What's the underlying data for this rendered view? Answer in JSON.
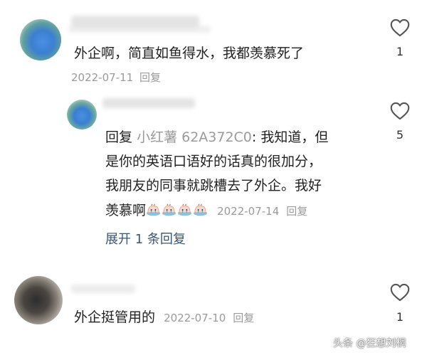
{
  "comments": [
    {
      "text": "外企啊，简直如鱼得水，我都羡慕死了",
      "date": "2022-07-11",
      "reply_label": "回复",
      "likes": "1"
    },
    {
      "reply_prefix": "回复",
      "reply_to": "小红薯 62A372C0",
      "line1": ": 我知道，但",
      "line2": "是你的英语口语好的话真的很加分，",
      "line3": "我朋友的同事就跳槽去了外企。我好",
      "line4": "羡慕啊",
      "emoji_name": "crying-face-emoji",
      "date": "2022-07-14",
      "reply_label": "回复",
      "likes": "5",
      "expand_label": "展开 1 条回复"
    },
    {
      "text": "外企挺管用的",
      "date": "2022-07-10",
      "reply_label": "回复",
      "likes": "1"
    }
  ],
  "watermark": "头条 @狂想刘桐",
  "colors": {
    "expand": "#3a5576",
    "meta": "#9a9a9a",
    "reply_to": "#9a9a9a",
    "heart": "#555555"
  },
  "icons": {
    "like": "heart-outline-icon"
  }
}
